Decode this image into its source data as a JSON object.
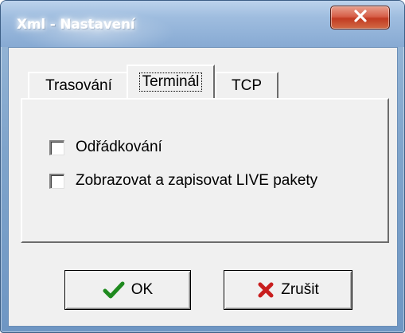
{
  "window": {
    "title": "Xml - Nastavení",
    "close_icon": "close-x-icon"
  },
  "tabs": [
    {
      "label": "Trasování",
      "active": false
    },
    {
      "label": "Terminál",
      "active": true
    },
    {
      "label": "TCP",
      "active": false
    }
  ],
  "terminal_tab": {
    "options": [
      {
        "label": "Odřádkování",
        "checked": false
      },
      {
        "label": "Zobrazovat a zapisovat LIVE pakety",
        "checked": false
      }
    ]
  },
  "buttons": {
    "ok": {
      "label": "OK",
      "icon": "checkmark-icon",
      "icon_color": "#1f8a1f"
    },
    "cancel": {
      "label": "Zrušit",
      "icon": "red-x-icon",
      "icon_color": "#c81e1e"
    }
  }
}
